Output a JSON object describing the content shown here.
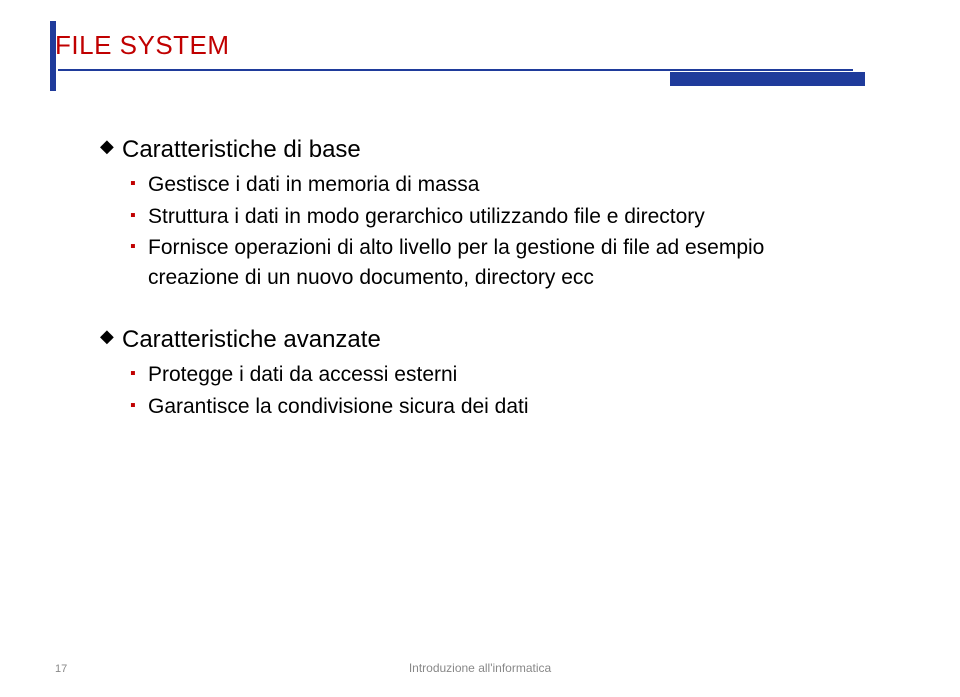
{
  "title": "FILE SYSTEM",
  "sections": [
    {
      "heading": "Caratteristiche di base",
      "items": [
        "Gestisce i dati in memoria di massa",
        "Struttura i dati in  modo gerarchico utilizzando file e directory",
        "Fornisce operazioni di alto livello per la gestione di file ad esempio creazione di un nuovo documento, directory ecc"
      ]
    },
    {
      "heading": "Caratteristiche avanzate",
      "items": [
        "Protegge i dati da accessi esterni",
        "Garantisce la condivisione sicura dei dati"
      ]
    }
  ],
  "footer": {
    "page": "17",
    "text": "Introduzione all'informatica"
  }
}
